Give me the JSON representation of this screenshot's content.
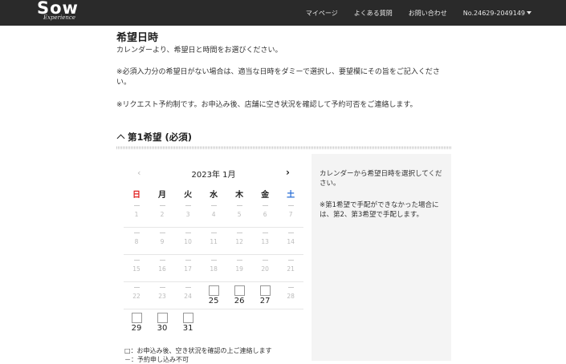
{
  "header": {
    "logo": "Sow",
    "logo_sub": "Experience",
    "nav": [
      "マイページ",
      "よくある質問",
      "お問い合わせ",
      "No.24629-2049149"
    ]
  },
  "main": {
    "heading": "希望日時",
    "p1": "カレンダーより、希望日と時間をお選びください。",
    "p2": "※必須入力分の希望日がない場合は、適当な日時をダミーで選択し、要望欄にその旨をご記入ください。",
    "p3": "※リクエスト予約制です。お申込み後、店舗に空き状況を確認して予約可否をご連絡します。",
    "section_title": "第1希望 (必須)"
  },
  "calendar": {
    "title": "2023年 1月",
    "prev": "‹",
    "next": "›",
    "weekdays": [
      "日",
      "月",
      "火",
      "水",
      "木",
      "金",
      "土"
    ],
    "weekday_colors": {
      "sun": "#e02020",
      "sat": "#2a6fd6"
    },
    "weeks": [
      [
        "1",
        "2",
        "3",
        "4",
        "5",
        "6",
        "7"
      ],
      [
        "8",
        "9",
        "10",
        "11",
        "12",
        "13",
        "14"
      ],
      [
        "15",
        "16",
        "17",
        "18",
        "19",
        "20",
        "21"
      ],
      [
        "22",
        "23",
        "24",
        "25",
        "26",
        "27",
        "28"
      ],
      [
        "29",
        "30",
        "31",
        "",
        "",
        "",
        ""
      ]
    ],
    "available_days": [
      "25",
      "26",
      "27",
      "29",
      "30",
      "31"
    ],
    "legend": [
      "□：お申込み後、空き状況を確認の上ご連絡します",
      "－：予約申し込み不可"
    ]
  },
  "side_panel": {
    "text1": "カレンダーから希望日時を選択してください。",
    "text2": "※第1希望で手配ができなかった場合には、第2、第3希望で手配します。"
  }
}
